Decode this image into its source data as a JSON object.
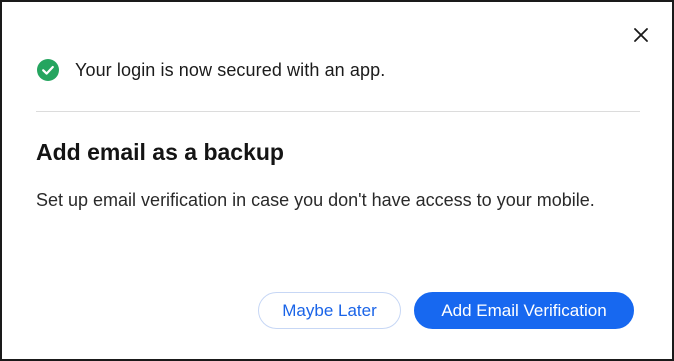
{
  "colors": {
    "accent": "#1768f0",
    "success": "#25a55f",
    "divider": "#dcdcdc"
  },
  "dialog": {
    "close_icon": "close-icon",
    "success": {
      "icon": "check-circle-icon",
      "message": "Your login is now secured with an app."
    },
    "title": "Add email as a backup",
    "description": "Set up email verification in case you don't have access to your mobile.",
    "buttons": {
      "secondary_label": "Maybe Later",
      "primary_label": "Add Email Verification"
    }
  }
}
